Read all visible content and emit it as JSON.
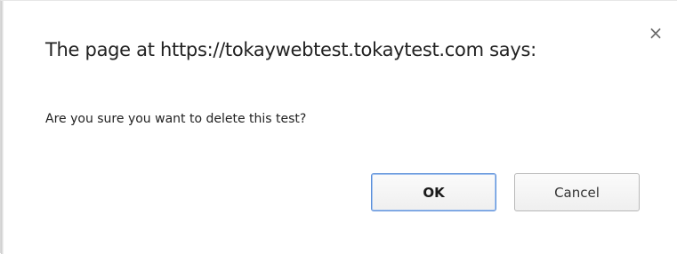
{
  "dialog": {
    "title": "The page at https://tokaywebtest.tokaytest.com says:",
    "close_icon": "close-icon",
    "close_glyph": "×",
    "message": "Are you sure you want to delete this test?",
    "ok_label": "OK",
    "cancel_label": "Cancel",
    "colors": {
      "ok_border": "#5b8fd9",
      "text": "#222222"
    }
  }
}
